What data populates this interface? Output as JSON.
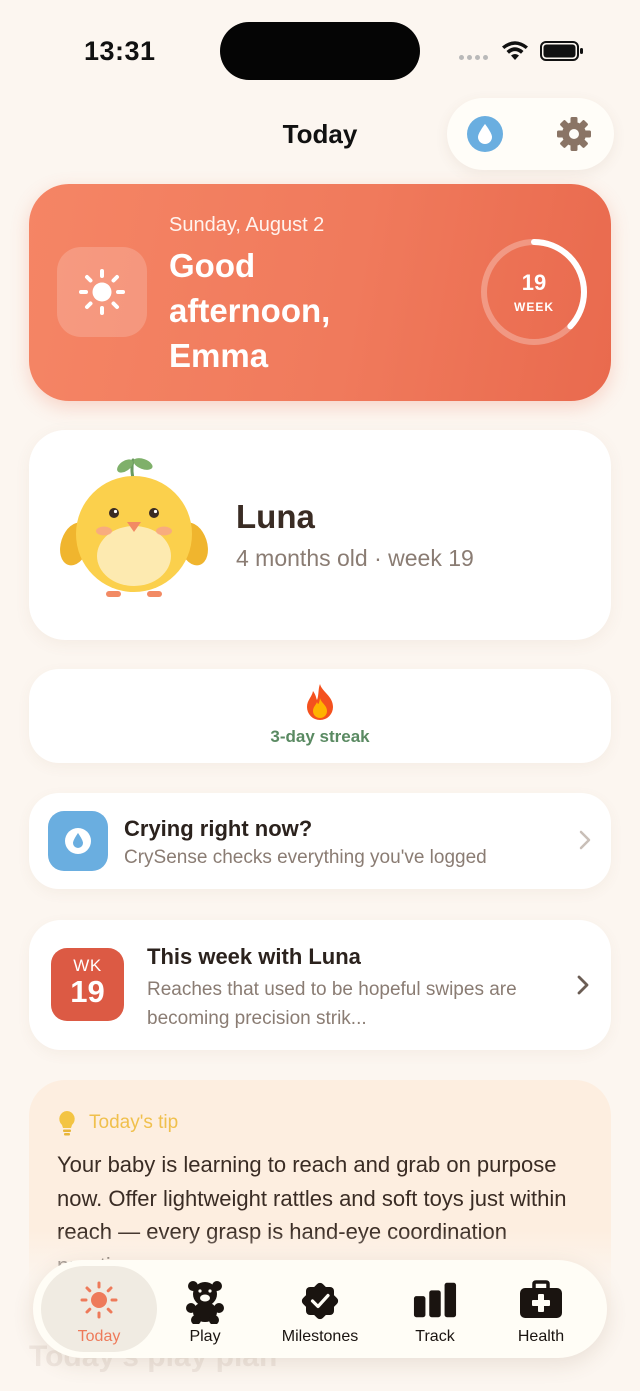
{
  "status_bar": {
    "time": "13:31"
  },
  "header": {
    "title": "Today"
  },
  "greeting": {
    "date": "Sunday, August 2",
    "message": "Good afternoon, Emma",
    "week_number": "19",
    "week_label": "WEEK",
    "week_progress": 0.37
  },
  "baby": {
    "name": "Luna",
    "age": "4 months old · week 19"
  },
  "streak": {
    "text": "3-day streak"
  },
  "crysense": {
    "title": "Crying right now?",
    "subtitle": "CrySense checks everything you've logged"
  },
  "week_card": {
    "badge_label": "WK",
    "badge_number": "19",
    "title": "This week with Luna",
    "subtitle": "Reaches that used to be hopeful swipes are becoming precision strik..."
  },
  "tip": {
    "label": "Today's tip",
    "text": "Your baby is learning to reach and grab on purpose now. Offer lightweight rattles and soft toys just within reach — every grasp is hand-eye coordination practice."
  },
  "next_section": {
    "title": "Today's play plan"
  },
  "tabs": [
    {
      "label": "Today",
      "icon": "sun-icon",
      "active": true
    },
    {
      "label": "Play",
      "icon": "teddy-bear-icon",
      "active": false
    },
    {
      "label": "Milestones",
      "icon": "badge-check-icon",
      "active": false
    },
    {
      "label": "Track",
      "icon": "bar-chart-icon",
      "active": false
    },
    {
      "label": "Health",
      "icon": "first-aid-kit-icon",
      "active": false
    }
  ],
  "colors": {
    "background": "#fcf6f0",
    "accent": "#f07a5c",
    "crysense_blue": "#6aaee0",
    "week_badge": "#dc5a44",
    "streak_green": "#5a8a62",
    "tip_yellow": "#f0c04d"
  }
}
